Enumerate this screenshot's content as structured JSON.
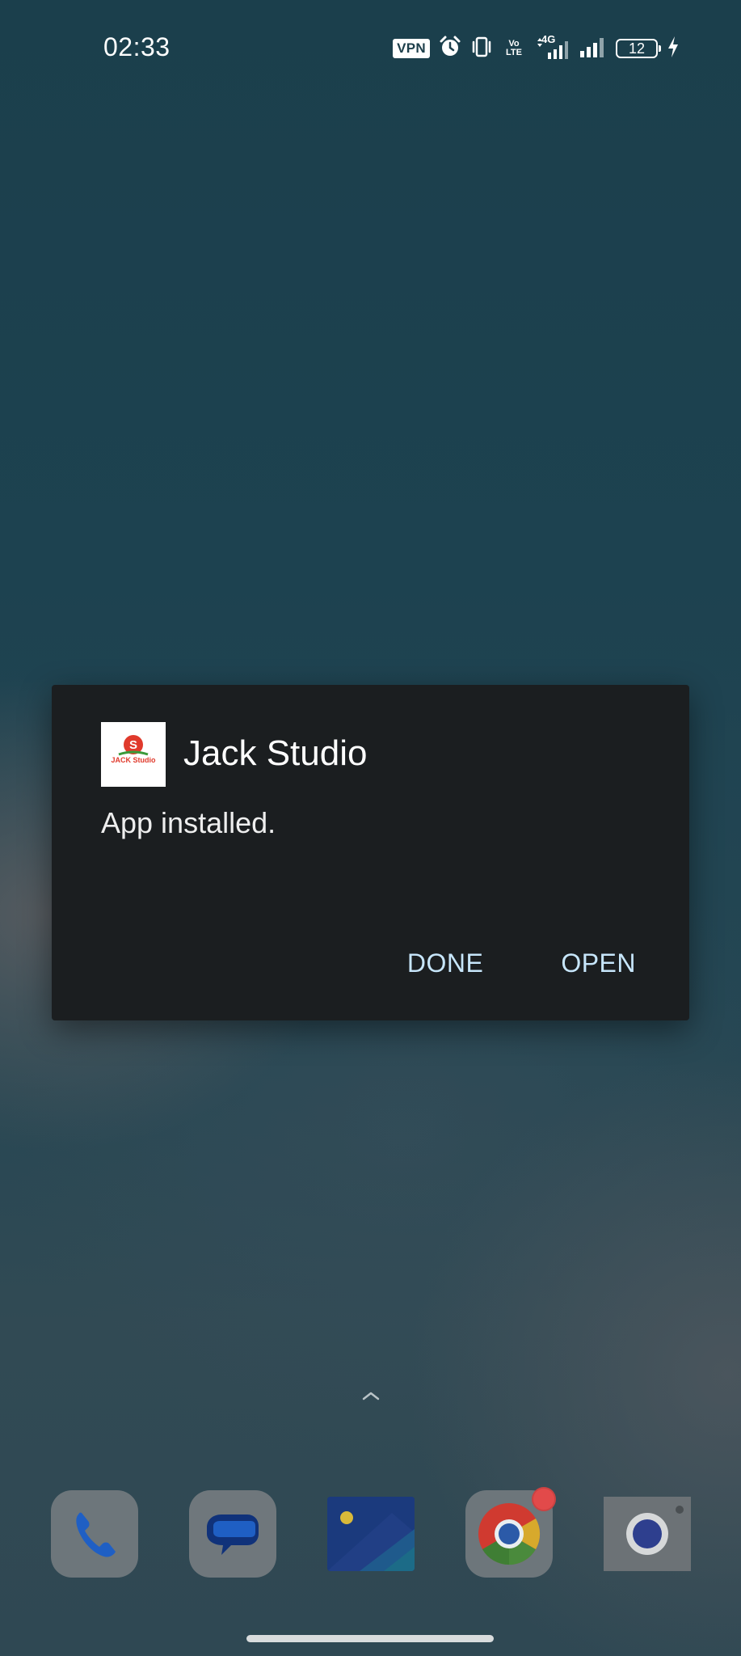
{
  "status_bar": {
    "time": "02:33",
    "vpn_label": "VPN",
    "volte_line1": "Vo",
    "volte_line2": "LTE",
    "network_type": "4G",
    "battery_level": "12",
    "icons": [
      "vpn-badge",
      "alarm-icon",
      "vibrate-icon",
      "volte-icon",
      "signal-4g-icon",
      "signal-icon",
      "battery-icon",
      "charging-bolt-icon"
    ]
  },
  "dialog": {
    "app_name": "Jack Studio",
    "message": "App installed.",
    "icon_text": "JACK Studio",
    "icon_letter": "S",
    "done_label": "DONE",
    "open_label": "OPEN"
  },
  "dock": {
    "apps": [
      "phone-app-icon",
      "messages-app-icon",
      "gallery-app-icon",
      "chrome-app-icon",
      "camera-app-icon"
    ],
    "chrome_has_notification": true
  },
  "colors": {
    "dialog_bg": "#1b1e20",
    "dialog_button": "#c7e6fb",
    "wallpaper_top": "#1b3f4c"
  }
}
